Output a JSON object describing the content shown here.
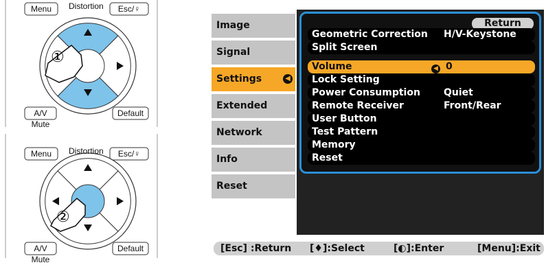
{
  "remote_top": {
    "menu_label": "Menu",
    "distortion_label": "Distortion",
    "esc_label": "Esc/♀",
    "av_mute_label": "A/V Mute",
    "default_label": "Default",
    "step_label": "①"
  },
  "remote_bottom": {
    "menu_label": "Menu",
    "distortion_label": "Distortion",
    "esc_label": "Esc/♀",
    "av_mute_label": "A/V Mute",
    "default_label": "Default",
    "step_label": "②"
  },
  "left_menu": {
    "items": [
      "Image",
      "Signal",
      "Settings",
      "Extended",
      "Network",
      "Info",
      "Reset"
    ],
    "selected": "Settings"
  },
  "submenu": {
    "return_label": "Return",
    "rows": [
      {
        "key": "Geometric Correction",
        "value": "H/V-Keystone"
      },
      {
        "key": "Split Screen",
        "value": ""
      },
      {
        "key": "Volume",
        "value": "0"
      },
      {
        "key": "Lock Setting",
        "value": ""
      },
      {
        "key": "Power Consumption",
        "value": "Quiet"
      },
      {
        "key": "Remote Receiver",
        "value": "Front/Rear"
      },
      {
        "key": "User Button",
        "value": ""
      },
      {
        "key": "Test Pattern",
        "value": ""
      },
      {
        "key": "Memory",
        "value": ""
      },
      {
        "key": "Reset",
        "value": ""
      }
    ],
    "selected": "Volume"
  },
  "footer": {
    "esc": "[Esc] :Return",
    "select": "[♦]:Select",
    "enter": "[◐]:Enter",
    "menu": "[Menu]:Exit"
  },
  "colors": {
    "highlight": "#f6a727",
    "frame": "#2a8fd6",
    "remote_active": "#7ec3ea"
  }
}
